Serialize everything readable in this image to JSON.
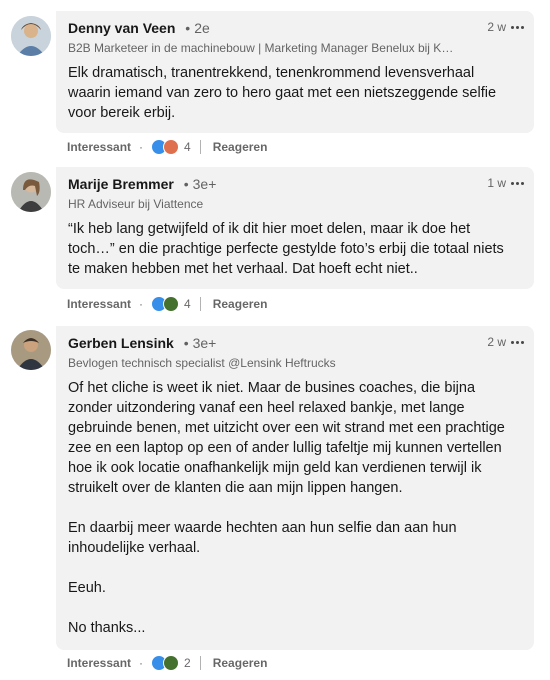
{
  "comments": [
    {
      "name": "Denny van Veen",
      "degree": "2e",
      "headline": "B2B Marketeer in de machinebouw | Marketing Manager Benelux bij K…",
      "time": "2 w",
      "text": "Elk dramatisch, tranentrekkend, tenenkrommend levensverhaal\nwaarin iemand van zero to hero gaat met een nietszeggende selfie\nvoor bereik erbij.",
      "reactions": [
        "clap",
        "heart"
      ],
      "reaction_count": "4",
      "like_label": "Interessant",
      "reply_label": "Reageren"
    },
    {
      "name": "Marije Bremmer",
      "degree": "3e+",
      "headline": "HR Adviseur bij Viattence",
      "time": "1 w",
      "text": "“Ik heb lang getwijfeld of ik dit hier moet delen, maar ik doe het\ntoch…” en die prachtige perfecte gestylde foto’s erbij die totaal niets\nte maken hebben met het verhaal. Dat hoeft echt niet..",
      "reactions": [
        "clap",
        "laugh"
      ],
      "reaction_count": "4",
      "like_label": "Interessant",
      "reply_label": "Reageren"
    },
    {
      "name": "Gerben Lensink",
      "degree": "3e+",
      "headline": "Bevlogen technisch specialist @Lensink Heftrucks",
      "time": "2 w",
      "text": "Of het cliche is weet ik niet. Maar de busines coaches, die bijna\nzonder uitzondering vanaf een heel relaxed bankje, met lange\ngebruinde benen, met uitzicht over een wit strand met een prachtige\nzee en een laptop op een of ander lullig tafeltje mij kunnen vertellen\nhoe ik ook locatie onafhankelijk mijn geld kan verdienen terwijl ik\nstruikelt over de klanten die aan mijn lippen hangen.\n\nEn daarbij meer waarde hechten aan hun selfie dan aan hun\ninhoudelijke verhaal.\n\nEeuh.\n\nNo thanks...",
      "reactions": [
        "clap",
        "laugh"
      ],
      "reaction_count": "2",
      "like_label": "Interessant",
      "reply_label": "Reageren"
    }
  ],
  "icons": {
    "clap": "clap-reaction-icon",
    "heart": "heart-reaction-icon",
    "laugh": "laugh-reaction-icon",
    "more": "more-options-icon"
  },
  "colors": {
    "clap": "#378fe9",
    "heart": "#df704d",
    "laugh": "#44712e",
    "bubble": "#f2f2f2"
  }
}
